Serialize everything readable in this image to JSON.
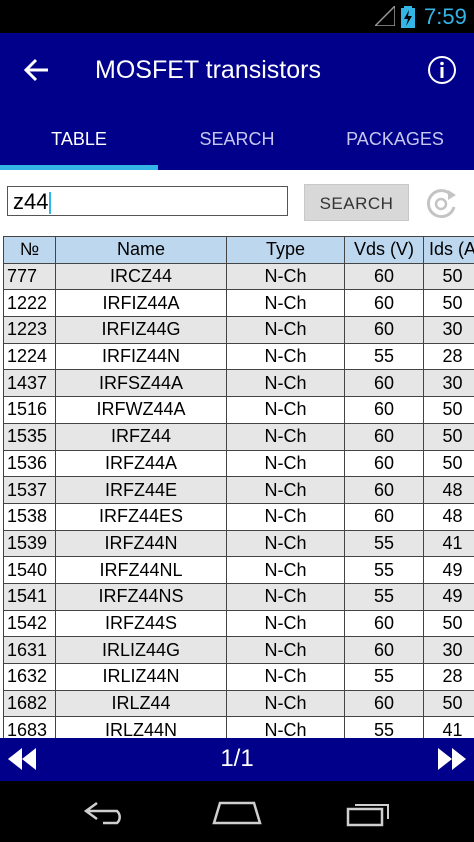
{
  "status_bar": {
    "time": "7:59"
  },
  "app_bar": {
    "title": "MOSFET transistors"
  },
  "tabs": [
    {
      "label": "TABLE",
      "active": true
    },
    {
      "label": "SEARCH",
      "active": false
    },
    {
      "label": "PACKAGES",
      "active": false
    }
  ],
  "search": {
    "value": "z44",
    "button_label": "SEARCH"
  },
  "table": {
    "headers": [
      "№",
      "Name",
      "Type",
      "Vds (V)",
      "Ids (A"
    ],
    "rows": [
      [
        "777",
        "IRCZ44",
        "N-Ch",
        "60",
        "50"
      ],
      [
        "1222",
        "IRFIZ44A",
        "N-Ch",
        "60",
        "50"
      ],
      [
        "1223",
        "IRFIZ44G",
        "N-Ch",
        "60",
        "30"
      ],
      [
        "1224",
        "IRFIZ44N",
        "N-Ch",
        "55",
        "28"
      ],
      [
        "1437",
        "IRFSZ44A",
        "N-Ch",
        "60",
        "30"
      ],
      [
        "1516",
        "IRFWZ44A",
        "N-Ch",
        "60",
        "50"
      ],
      [
        "1535",
        "IRFZ44",
        "N-Ch",
        "60",
        "50"
      ],
      [
        "1536",
        "IRFZ44A",
        "N-Ch",
        "60",
        "50"
      ],
      [
        "1537",
        "IRFZ44E",
        "N-Ch",
        "60",
        "48"
      ],
      [
        "1538",
        "IRFZ44ES",
        "N-Ch",
        "60",
        "48"
      ],
      [
        "1539",
        "IRFZ44N",
        "N-Ch",
        "55",
        "41"
      ],
      [
        "1540",
        "IRFZ44NL",
        "N-Ch",
        "55",
        "49"
      ],
      [
        "1541",
        "IRFZ44NS",
        "N-Ch",
        "55",
        "49"
      ],
      [
        "1542",
        "IRFZ44S",
        "N-Ch",
        "60",
        "50"
      ],
      [
        "1631",
        "IRLIZ44G",
        "N-Ch",
        "60",
        "30"
      ],
      [
        "1632",
        "IRLIZ44N",
        "N-Ch",
        "55",
        "28"
      ],
      [
        "1682",
        "IRLZ44",
        "N-Ch",
        "60",
        "50"
      ],
      [
        "1683",
        "IRLZ44N",
        "N-Ch",
        "55",
        "41"
      ]
    ]
  },
  "pagination": {
    "label": "1/1"
  },
  "colors": {
    "primary": "#00008b",
    "accent": "#33b5e5",
    "header_cell": "#bdd7ee",
    "row_alt": "#e6e6e6"
  },
  "icons": {
    "back": "arrow-left-icon",
    "info": "info-icon",
    "refresh": "refresh-icon",
    "prev": "rewind-icon",
    "next": "fast-forward-icon",
    "sys_back": "back-nav-icon",
    "sys_home": "home-nav-icon",
    "sys_recent": "recent-apps-icon"
  }
}
